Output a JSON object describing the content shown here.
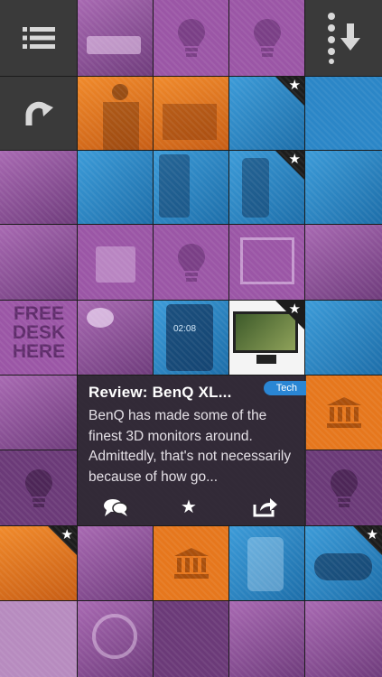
{
  "toolbar": {
    "menu_icon": "list-menu-icon",
    "refresh_icon": "refresh-icon",
    "more_icon": "vertical-dots-download-icon"
  },
  "featured_card": {
    "title": "Review: BenQ XL...",
    "category_tag": "Tech",
    "excerpt": "BenQ has made some of the finest 3D monitors around. Admittedly, that's not necessarily because of how go...",
    "actions": [
      "comments-icon",
      "star-icon",
      "share-icon"
    ]
  },
  "tiles": {
    "free_desk_text_1": "FREE",
    "free_desk_text_2": "DESK",
    "free_desk_text_3": "HERE",
    "phone_time": "02:08"
  },
  "colors": {
    "purple": "#9b56a6",
    "orange": "#e6771d",
    "blue": "#2b86c7",
    "tag_blue": "#2a86d4",
    "toolbar_gray": "#3a3a3a"
  }
}
